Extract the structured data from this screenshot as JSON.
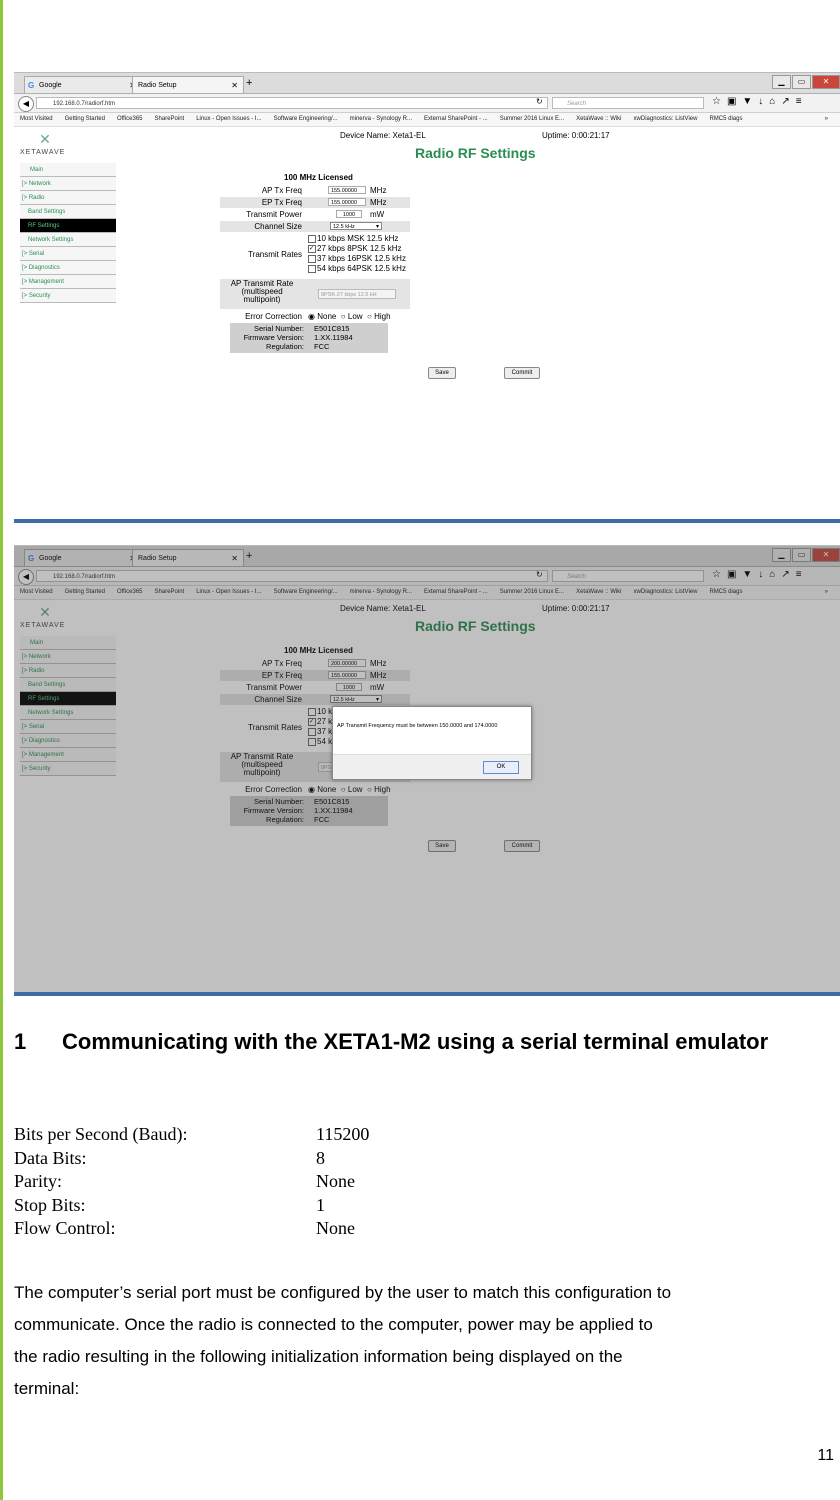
{
  "browser": {
    "tabs": [
      "Google",
      "Radio Setup"
    ],
    "url": "192.168.0.7/radiorf.htm",
    "search_placeholder": "Search",
    "bookmarks": [
      "Most Visited",
      "Getting Started",
      "Office365",
      "SharePoint",
      "Linux - Open Issues - I...",
      "Software Engineering/...",
      "minerva - Synology R...",
      "External SharePoint - ...",
      "Summer 2016 Linux E...",
      "XetaWave :: Wiki",
      "xwDiagnostics: ListView",
      "RMC5 diags"
    ]
  },
  "app": {
    "logo_text": "XETAWAVE",
    "device_name": "Device Name: Xeta1-EL",
    "uptime": "Uptime: 0:00:21:17",
    "title": "Radio RF Settings",
    "sidebar": [
      "Main",
      "[> Network",
      "[> Radio",
      "Band Settings",
      "RF Settings",
      "Network Settings",
      "[> Serial",
      "[> Diagnostics",
      "[> Management",
      "[> Security"
    ],
    "form": {
      "heading": "100 MHz Licensed",
      "ap_tx_label": "AP Tx Freq",
      "ap_tx_value_1": "155.00000",
      "ap_tx_value_2": "200.00000",
      "ep_tx_label": "EP Tx Freq",
      "ep_tx_value": "155.00000",
      "mhz": "MHz",
      "power_label": "Transmit Power",
      "power_value": "1000",
      "mw": "mW",
      "channel_label": "Channel Size",
      "channel_value": "12.5 kHz",
      "rates_label": "Transmit Rates",
      "rates": [
        "10 kbps MSK 12.5 kHz",
        "27 kbps 8PSK 12.5 kHz",
        "37 kbps 16PSK 12.5 kHz",
        "54 kbps 64PSK 12.5 kHz"
      ],
      "rates_checked": [
        false,
        true,
        false,
        false
      ],
      "ap_rate_label_1": "AP Transmit Rate",
      "ap_rate_label_2": "(multispeed",
      "ap_rate_label_3": "multipoint)",
      "ap_rate_value": "8PSK-27 kbps 12.5 kH",
      "error_label": "Error Correction",
      "error_options": [
        "None",
        "Low",
        "High"
      ],
      "serial_label": "Serial Number:",
      "serial_value": "E501C815",
      "firmware_label": "Firmware Version:",
      "firmware_value": "1.XX.11984",
      "regulation_label": "Regulation:",
      "regulation_value": "FCC",
      "save": "Save",
      "commit": "Commit"
    },
    "dialog": {
      "message": "AP Transmit Frequency must be between 150.0000 and 174.0000",
      "ok": "OK"
    }
  },
  "document": {
    "section_number": "1",
    "section_title": "Communicating with the XETA1-M2  using a serial terminal emulator",
    "settings": [
      {
        "key": "Bits per Second (Baud):",
        "value": "115200"
      },
      {
        "key": "Data Bits:",
        "value": "8"
      },
      {
        "key": "Parity:",
        "value": "None"
      },
      {
        "key": "Stop Bits:",
        "value": "1"
      },
      {
        "key": "Flow Control:",
        "value": "None"
      }
    ],
    "paragraph_lines": [
      "The computer’s serial port must be configured by the user to match this configuration to",
      "communicate.   Once the radio is connected to the computer, power may be applied to",
      "the radio resulting in the following initialization information being displayed on the",
      "terminal:"
    ],
    "page_number": "11"
  },
  "colors": {
    "accent_green": "#2a8d52",
    "page_rule": "#8dc63f"
  }
}
